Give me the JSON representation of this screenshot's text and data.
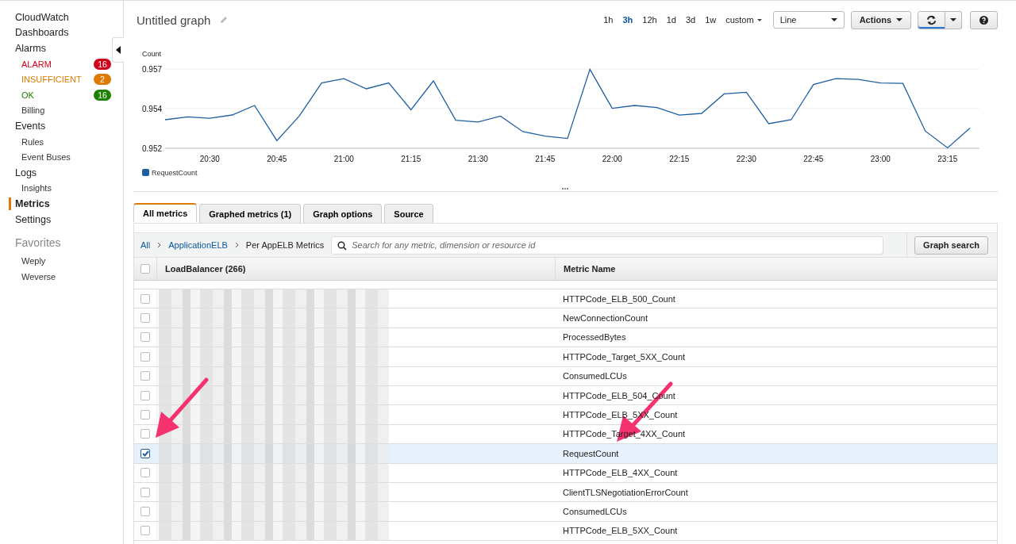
{
  "sidebar": {
    "items": [
      {
        "label": "CloudWatch",
        "kind": "top",
        "selected": false
      },
      {
        "label": "Dashboards",
        "kind": "top",
        "selected": false
      },
      {
        "label": "Alarms",
        "kind": "top",
        "selected": false
      },
      {
        "label": "ALARM",
        "kind": "status",
        "color": "#d0021b",
        "count": "16",
        "selected": false
      },
      {
        "label": "INSUFFICIENT",
        "kind": "status",
        "color": "#e07b00",
        "count": "2",
        "selected": false
      },
      {
        "label": "OK",
        "kind": "status",
        "color": "#1d8102",
        "count": "16",
        "selected": false
      },
      {
        "label": "Billing",
        "kind": "sub",
        "selected": false
      },
      {
        "label": "Events",
        "kind": "top",
        "selected": false
      },
      {
        "label": "Rules",
        "kind": "sub",
        "selected": false
      },
      {
        "label": "Event Buses",
        "kind": "sub",
        "selected": false
      },
      {
        "label": "Logs",
        "kind": "top",
        "selected": false
      },
      {
        "label": "Insights",
        "kind": "sub",
        "selected": false
      },
      {
        "label": "Metrics",
        "kind": "top",
        "selected": true
      },
      {
        "label": "Settings",
        "kind": "top",
        "selected": false
      }
    ],
    "favorites": {
      "title": "Favorites",
      "items": [
        {
          "label": "Weply"
        },
        {
          "label": "Weverse"
        }
      ]
    }
  },
  "header": {
    "title": "Untitled graph",
    "time_ranges": [
      {
        "label": "1h",
        "selected": false
      },
      {
        "label": "3h",
        "selected": true
      },
      {
        "label": "12h",
        "selected": false
      },
      {
        "label": "1d",
        "selected": false
      },
      {
        "label": "3d",
        "selected": false
      },
      {
        "label": "1w",
        "selected": false
      }
    ],
    "custom_range": "custom",
    "chart_type": "Line",
    "actions_button": "Actions"
  },
  "graph": {
    "chart_data": {
      "type": "line",
      "ylabel": "Count",
      "categories": [
        null,
        null,
        "20:30",
        null,
        null,
        "20:45",
        null,
        null,
        "21:00",
        null,
        null,
        "21:15",
        null,
        null,
        "21:30",
        null,
        null,
        "21:45",
        null,
        null,
        "22:00",
        null,
        null,
        "22:15",
        null,
        null,
        "22:30",
        null,
        null,
        "22:45",
        null,
        null,
        "23:00",
        null,
        null,
        "23:15",
        null
      ],
      "series": [
        {
          "name": "RequestCount",
          "color": "#1f5f9f",
          "values": [
            0.9533,
            0.95348,
            0.95339,
            0.9536,
            0.9542,
            0.95198,
            0.95353,
            0.95562,
            0.95589,
            0.95525,
            0.95562,
            0.95393,
            0.95575,
            0.95327,
            0.95316,
            0.95353,
            0.95255,
            0.95227,
            0.95212,
            0.95648,
            0.95402,
            0.9542,
            0.95407,
            0.95359,
            0.9537,
            0.95493,
            0.95503,
            0.95305,
            0.9533,
            0.95552,
            0.95589,
            0.95584,
            0.95562,
            0.95559,
            0.95259,
            0.95153,
            0.95277
          ]
        }
      ],
      "ylim": [
        0.9515,
        0.9565
      ],
      "yticks": [
        {
          "value": 0.9515,
          "label": "0.952"
        },
        {
          "value": 0.954,
          "label": "0.954"
        },
        {
          "value": 0.9565,
          "label": "0.957"
        }
      ]
    }
  },
  "tabs": [
    {
      "label": "All metrics",
      "selected": true
    },
    {
      "label": "Graphed metrics (1)",
      "selected": false
    },
    {
      "label": "Graph options",
      "selected": false
    },
    {
      "label": "Source",
      "selected": false
    }
  ],
  "breadcrumb": [
    {
      "label": "All",
      "kind": "link"
    },
    {
      "label": "ApplicationELB",
      "kind": "link"
    },
    {
      "label": "Per AppELB Metrics",
      "kind": "current"
    }
  ],
  "search": {
    "placeholder": "Search for any metric, dimension or resource id"
  },
  "graph_search_button": "Graph search",
  "table": {
    "select_all_checked": false,
    "columns": [
      {
        "label": "LoadBalancer",
        "count": "(266)"
      },
      {
        "label": "Metric Name"
      }
    ],
    "rows": [
      {
        "metric": "HTTPCode_ELB_500_Count",
        "checked": false
      },
      {
        "metric": "NewConnectionCount",
        "checked": false
      },
      {
        "metric": "ProcessedBytes",
        "checked": false
      },
      {
        "metric": "HTTPCode_Target_5XX_Count",
        "checked": false
      },
      {
        "metric": "ConsumedLCUs",
        "checked": false
      },
      {
        "metric": "HTTPCode_ELB_504_Count",
        "checked": false
      },
      {
        "metric": "HTTPCode_ELB_5XX_Count",
        "checked": false
      },
      {
        "metric": "HTTPCode_Target_4XX_Count",
        "checked": false
      },
      {
        "metric": "RequestCount",
        "checked": true
      },
      {
        "metric": "HTTPCode_ELB_4XX_Count",
        "checked": false
      },
      {
        "metric": "ClientTLSNegotiationErrorCount",
        "checked": false
      },
      {
        "metric": "ConsumedLCUs",
        "checked": false
      },
      {
        "metric": "HTTPCode_ELB_5XX_Count",
        "checked": false
      }
    ]
  }
}
